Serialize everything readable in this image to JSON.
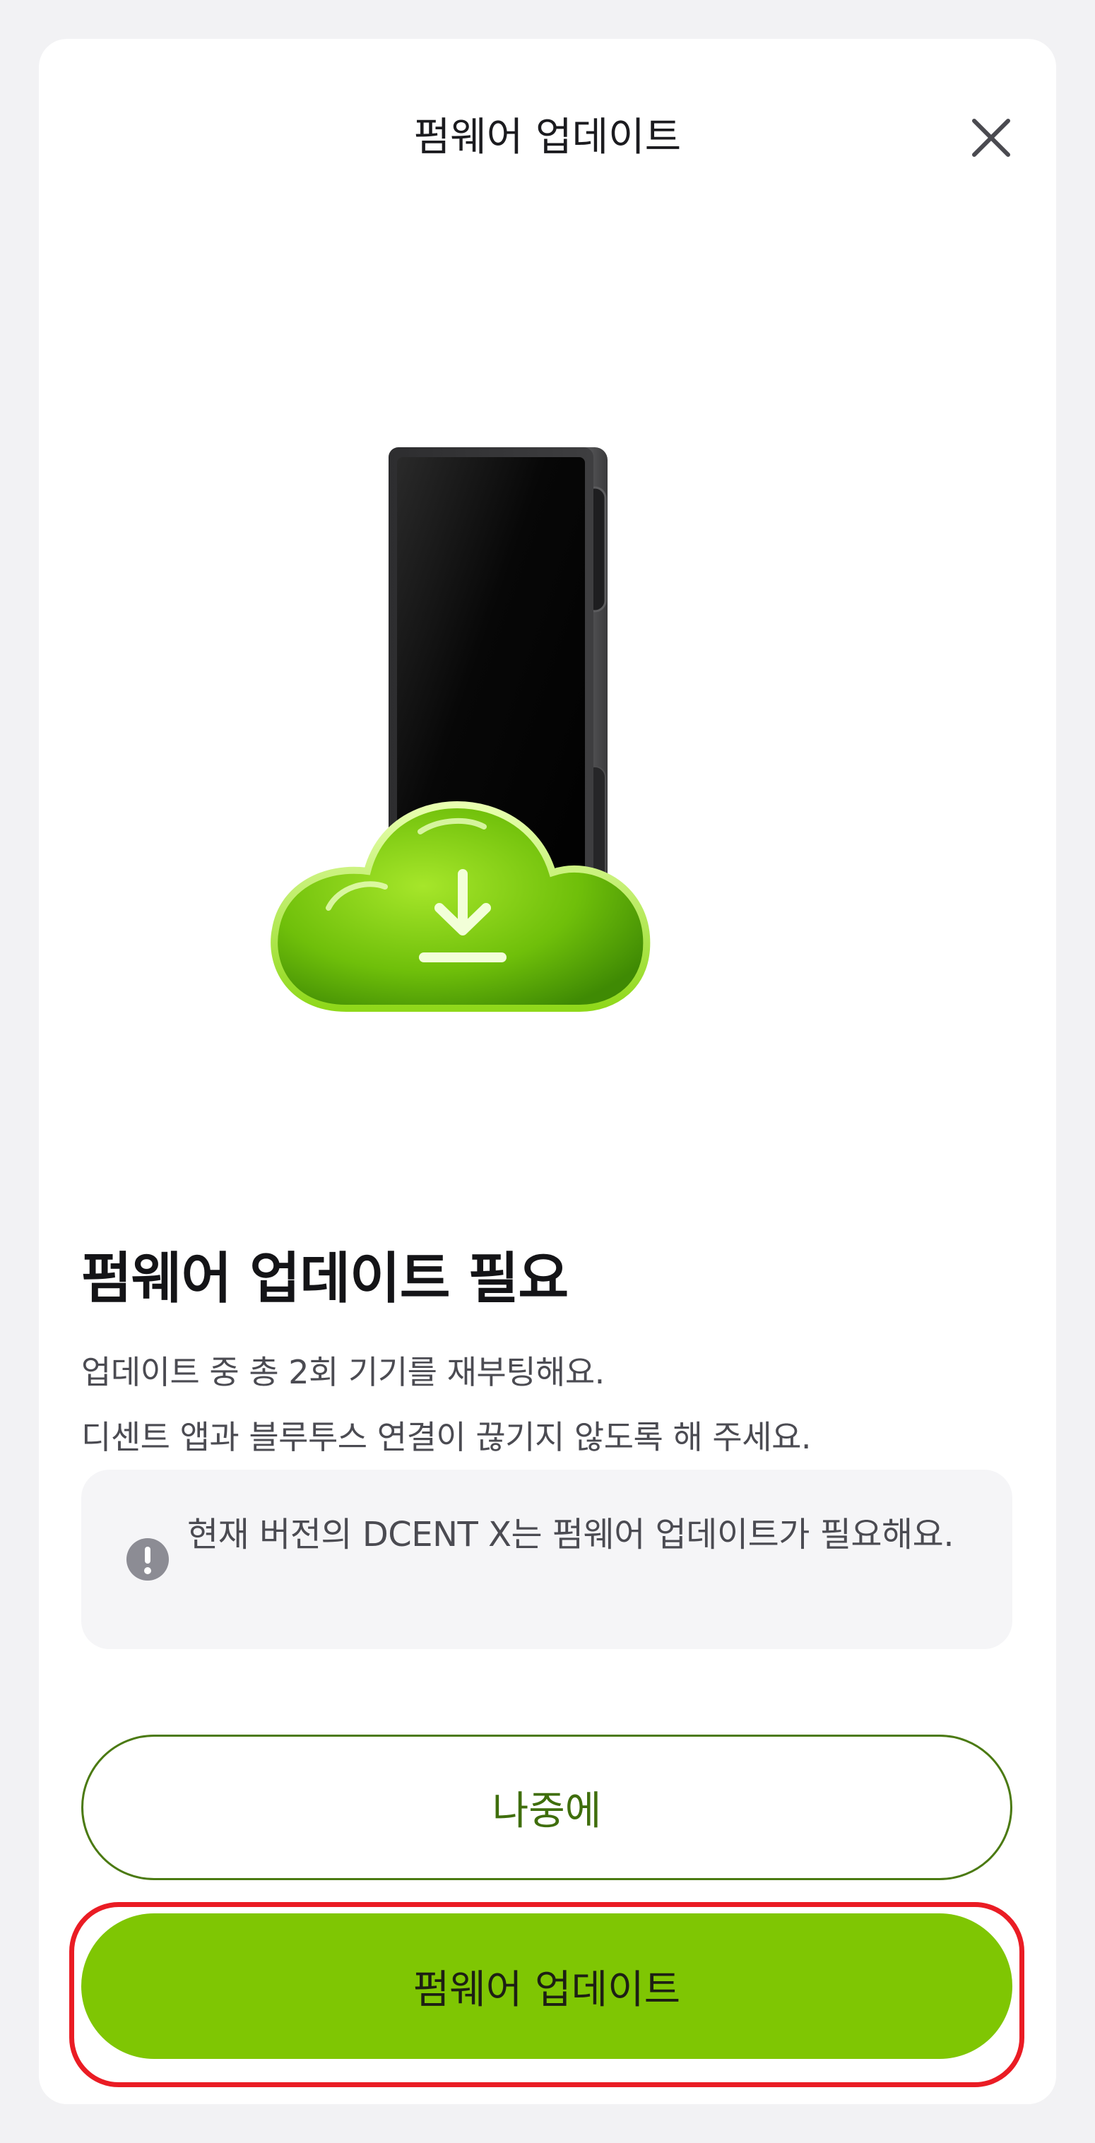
{
  "header": {
    "title": "펌웨어 업데이트",
    "close_icon": "close-icon"
  },
  "hero": {
    "device_icon": "hardware-wallet-device",
    "cloud_icon": "cloud-download-icon",
    "accent": "#7fc603"
  },
  "content": {
    "title": "펌웨어 업데이트 필요",
    "description_line1": "업데이트 중 총 2회 기기를 재부팅해요.",
    "description_line2": "디센트 앱과 블루투스 연결이 끊기지 않도록 해 주세요."
  },
  "notice": {
    "icon": "exclamation-icon",
    "text": "현재 버전의 DCENT X는 펌웨어 업데이트가 필요해요."
  },
  "buttons": {
    "later_label": "나중에",
    "update_label": "펌웨어 업데이트"
  },
  "colors": {
    "primary": "#7fc603",
    "outline": "#4b7a12",
    "highlight": "#ea1c24"
  }
}
